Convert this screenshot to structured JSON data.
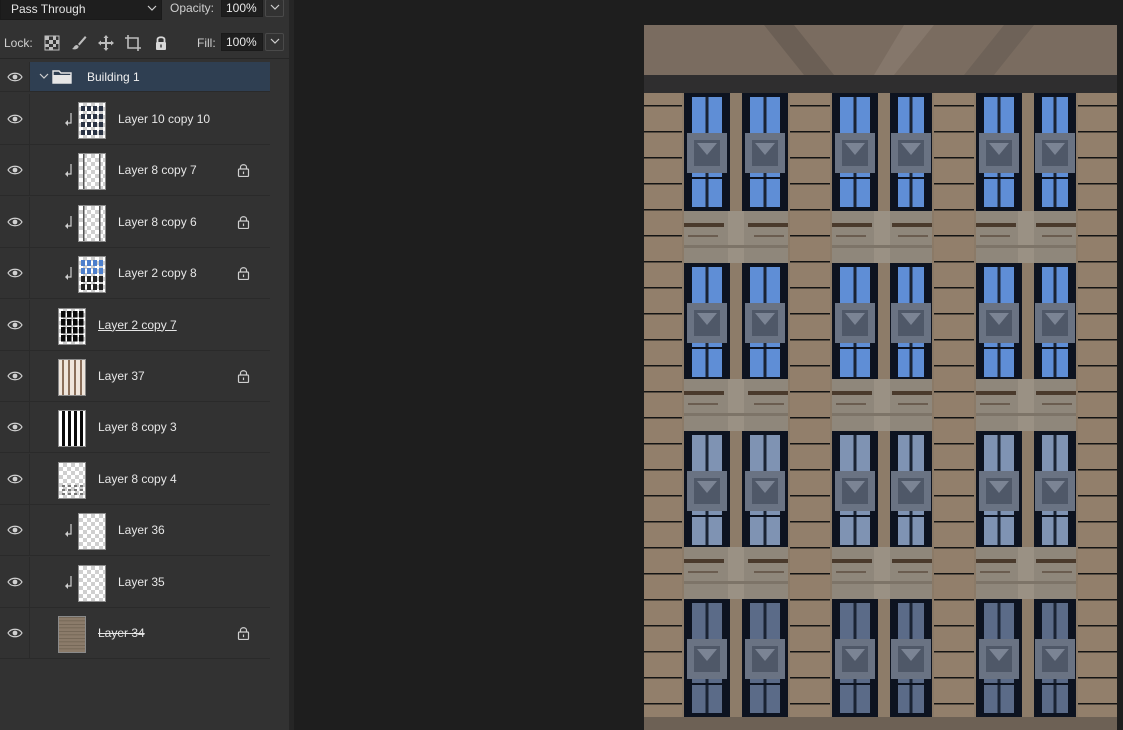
{
  "toolbar": {
    "blend_mode": "Pass Through",
    "opacity_label": "Opacity:",
    "opacity_value": "100%",
    "lock_label": "Lock:",
    "fill_label": "Fill:",
    "fill_value": "100%"
  },
  "group": {
    "name": "Building 1",
    "expanded": true,
    "selected": true
  },
  "layers": [
    {
      "name": "Layer 10 copy 10",
      "clipped": true,
      "locked": false,
      "style": "normal",
      "thumb": "windows-grid"
    },
    {
      "name": "Layer 8 copy 7",
      "clipped": true,
      "locked": true,
      "style": "normal",
      "thumb": "transparent-bars"
    },
    {
      "name": "Layer 8 copy 6",
      "clipped": true,
      "locked": true,
      "style": "normal",
      "thumb": "transparent-bars"
    },
    {
      "name": "Layer 2 copy 8",
      "clipped": true,
      "locked": true,
      "style": "normal",
      "thumb": "blue-windows"
    },
    {
      "name": "Layer 2 copy 7",
      "clipped": false,
      "locked": false,
      "style": "underlined",
      "thumb": "black-windows"
    },
    {
      "name": "Layer 37",
      "clipped": false,
      "locked": true,
      "style": "normal",
      "thumb": "pillars"
    },
    {
      "name": "Layer 8 copy 3",
      "clipped": false,
      "locked": false,
      "style": "normal",
      "thumb": "black-stripes"
    },
    {
      "name": "Layer 8 copy 4",
      "clipped": false,
      "locked": false,
      "style": "normal",
      "thumb": "small-dots"
    },
    {
      "name": "Layer 36",
      "clipped": true,
      "locked": false,
      "style": "normal",
      "thumb": "transparent"
    },
    {
      "name": "Layer 35",
      "clipped": true,
      "locked": false,
      "style": "normal",
      "thumb": "transparent"
    },
    {
      "name": "Layer 34",
      "clipped": false,
      "locked": true,
      "style": "strike",
      "thumb": "texture"
    }
  ],
  "colors": {
    "panel_bg": "#323232",
    "selected_row": "#2f3f52",
    "canvas_bg": "#1e1e1e",
    "facade": "#8a7a68",
    "window_sky": "#5f8ed6",
    "window_frame": "#0d1320",
    "pillar": "#9a8a76",
    "cross_band": "#8f877b"
  }
}
